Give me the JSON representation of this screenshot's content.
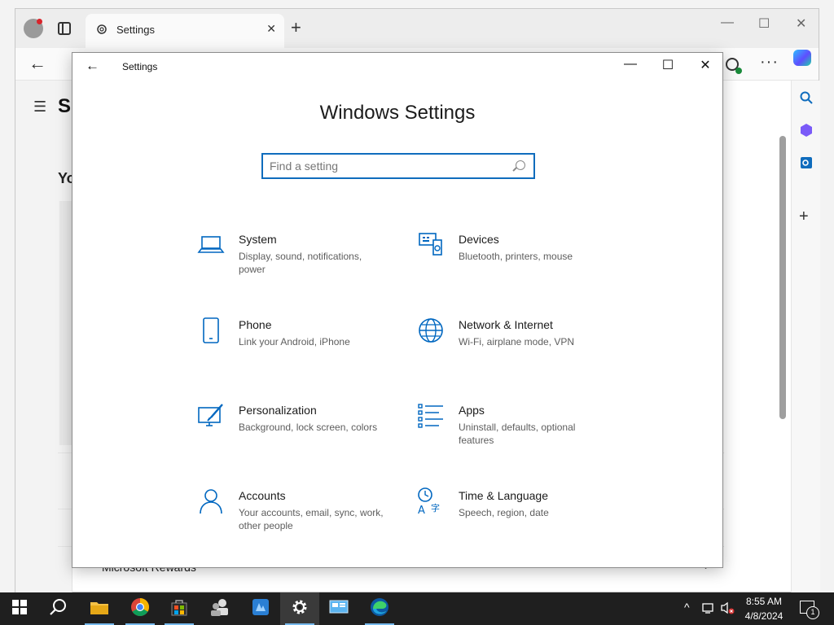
{
  "browser": {
    "tab_title": "Settings",
    "tab_close": "✕",
    "new_tab": "+",
    "window_controls": [
      "—",
      "☐",
      "✕"
    ],
    "more_label": "···",
    "page_title_fragment": "S",
    "page_subtitle_fragment": "Yo",
    "rewards_label": "Microsoft Rewards",
    "rewards_chevron": "›"
  },
  "settings": {
    "window_title": "Settings",
    "back": "←",
    "minimize": "—",
    "maximize": "☐",
    "close": "✕",
    "heading": "Windows Settings",
    "search_placeholder": "Find a setting",
    "categories": [
      {
        "title": "System",
        "desc": "Display, sound, notifications, power",
        "icon": "laptop-icon"
      },
      {
        "title": "Devices",
        "desc": "Bluetooth, printers, mouse",
        "icon": "devices-icon"
      },
      {
        "title": "Phone",
        "desc": "Link your Android, iPhone",
        "icon": "phone-icon"
      },
      {
        "title": "Network & Internet",
        "desc": "Wi-Fi, airplane mode, VPN",
        "icon": "globe-icon"
      },
      {
        "title": "Personalization",
        "desc": "Background, lock screen, colors",
        "icon": "paintbrush-icon"
      },
      {
        "title": "Apps",
        "desc": "Uninstall, defaults, optional features",
        "icon": "apps-list-icon"
      },
      {
        "title": "Accounts",
        "desc": "Your accounts, email, sync, work, other people",
        "icon": "person-icon"
      },
      {
        "title": "Time & Language",
        "desc": "Speech, region, date",
        "icon": "time-language-icon"
      }
    ]
  },
  "taskbar": {
    "apps": [
      "start-icon",
      "search-icon",
      "file-explorer-icon",
      "chrome-icon",
      "store-icon",
      "people-icon",
      "app-icon",
      "settings-icon",
      "remote-desktop-icon",
      "edge-icon"
    ],
    "time": "8:55 AM",
    "date": "4/8/2024",
    "notification_count": "1"
  },
  "colors": {
    "accent": "#0067c0",
    "taskbar": "#1f1f1f",
    "search_border": "#0f6cbd"
  }
}
